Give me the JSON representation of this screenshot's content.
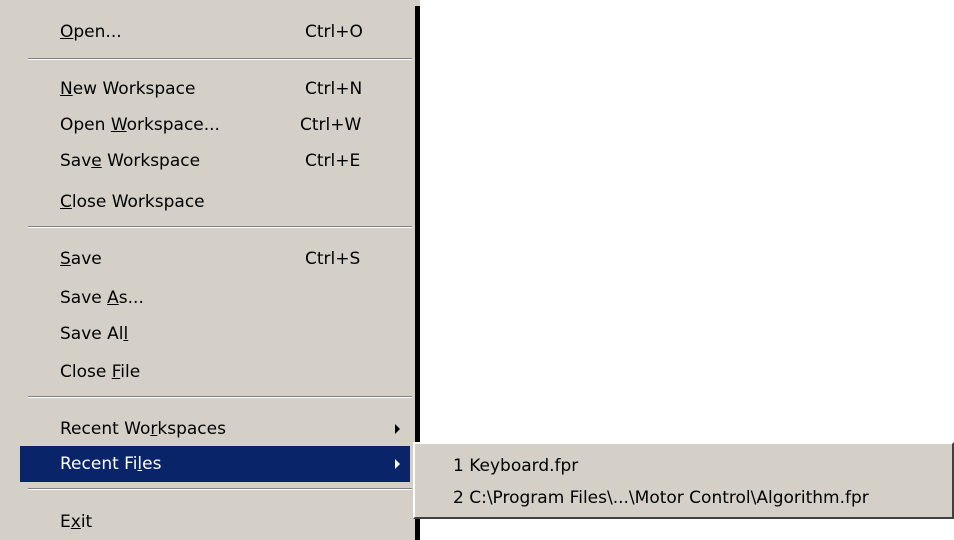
{
  "file_menu": {
    "items": [
      {
        "pre": "",
        "key": "O",
        "post": "pen...",
        "shortcut": "Ctrl+O"
      },
      {
        "pre": "",
        "key": "N",
        "post": "ew Workspace",
        "shortcut": "Ctrl+N"
      },
      {
        "pre": "Open ",
        "key": "W",
        "post": "orkspace...",
        "shortcut": "Ctrl+W"
      },
      {
        "pre": "Sav",
        "key": "e",
        "post": " Workspace",
        "shortcut": "Ctrl+E"
      },
      {
        "pre": "",
        "key": "C",
        "post": "lose Workspace",
        "shortcut": ""
      },
      {
        "pre": "",
        "key": "S",
        "post": "ave",
        "shortcut": "Ctrl+S"
      },
      {
        "pre": "Save ",
        "key": "A",
        "post": "s...",
        "shortcut": ""
      },
      {
        "pre": "Save Al",
        "key": "l",
        "post": "",
        "shortcut": ""
      },
      {
        "pre": "Close ",
        "key": "F",
        "post": "ile",
        "shortcut": ""
      },
      {
        "pre": "Recent Wo",
        "key": "r",
        "post": "kspaces",
        "shortcut": ""
      },
      {
        "pre": "Recent Fi",
        "key": "l",
        "post": "es",
        "shortcut": ""
      },
      {
        "pre": "E",
        "key": "x",
        "post": "it",
        "shortcut": ""
      }
    ]
  },
  "recent_files_submenu": {
    "items": [
      "1 Keyboard.fpr",
      "2 C:\\Program Files\\...\\Motor Control\\Algorithm.fpr"
    ]
  },
  "colors": {
    "menu_bg": "#d4d0c8",
    "highlight": "#0a246a",
    "highlight_text": "#ffffff"
  },
  "icons": {
    "submenu_arrow": "triangle-right"
  }
}
